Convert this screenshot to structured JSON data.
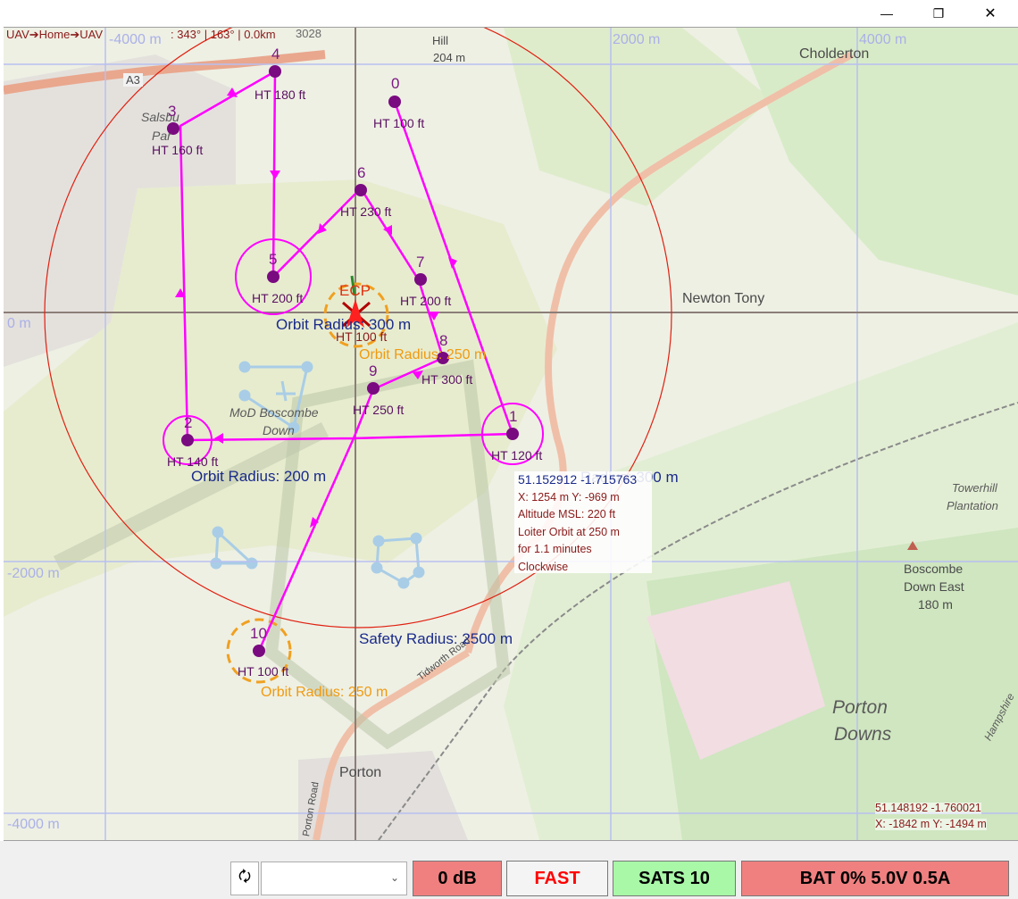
{
  "window": {
    "minimize_glyph": "—",
    "restore_glyph": "❐",
    "close_glyph": "✕"
  },
  "map": {
    "breadcrumb": "UAV➔Home➔UAV",
    "bearing_readout": ": 343° | 163° | 0.0km",
    "hud_number": "3028",
    "grid_labels": [
      "-4000 m",
      "2000 m",
      "4000 m",
      "0 m",
      "-2000 m",
      "-4000 m"
    ],
    "places": {
      "hill": "Hill",
      "hill_height": "204 m",
      "cholderton": "Cholderton",
      "newton_tony": "Newton Tony",
      "a3": "A3",
      "salsbury": "Salsbu",
      "park": "Par",
      "mod_boscombe_1": "MoD Boscombe",
      "mod_boscombe_2": "Down",
      "towerhill_1": "Towerhill",
      "towerhill_2": "Plantation",
      "boscombe_east_1": "Boscombe",
      "boscombe_east_2": "Down East",
      "boscombe_east_3": "180 m",
      "porton_downs_1": "Porton",
      "porton_downs_2": "Downs",
      "porton": "Porton",
      "road_tidworth": "Tidworth Road",
      "road_porton": "Porton Road",
      "hampshire": "Hampshire"
    },
    "waypoints": [
      {
        "num": "0",
        "ht": "HT 100 ft"
      },
      {
        "num": "1",
        "ht": "HT 120 ft"
      },
      {
        "num": "2",
        "ht": "HT 140 ft"
      },
      {
        "num": "3",
        "ht": "HT 160 ft"
      },
      {
        "num": "4",
        "ht": "HT 180 ft"
      },
      {
        "num": "5",
        "ht": "HT 200 ft"
      },
      {
        "num": "6",
        "ht": "HT 230 ft"
      },
      {
        "num": "7",
        "ht": "HT 200 ft"
      },
      {
        "num": "8",
        "ht": "HT 300 ft"
      },
      {
        "num": "9",
        "ht": "HT 250 ft"
      },
      {
        "num": "10",
        "ht": "HT 100 ft"
      }
    ],
    "ecp_label": "ECP",
    "home_ht": "HT 100 ft",
    "orbit_labels": {
      "wp5": "Orbit Radius: 300 m",
      "home": "Orbit Radius: 250 m",
      "wp2": "Orbit Radius: 200 m",
      "wp1": "Radius: 300 m",
      "wp10": "Orbit Radius: 250 m"
    },
    "safety_radius": "Safety Radius: 2500 m",
    "tooltip": {
      "coords": "51.152912 -1.715763",
      "xy": "X: 1254 m Y: -969 m",
      "altitude": "Altitude MSL: 220 ft",
      "loiter": "Loiter Orbit at 250 m",
      "duration": " for 1.1 minutes",
      "direction": " Clockwise"
    },
    "cursor_readout": {
      "latlon": "51.148192 -1.760021",
      "xy": "X: -1842 m Y: -1494 m"
    }
  },
  "statusbar": {
    "refresh_glyph": "🗘",
    "combo_value": "",
    "combo_arrow": "⌄",
    "signal": "0 dB",
    "speed": "FAST",
    "sats": "SATS 10",
    "battery": "BAT 0% 5.0V 0.5A"
  },
  "colors": {
    "waypoint": "#7a0a80",
    "route": "#ff00ff",
    "safety_circle": "#e02010",
    "orbit_orange": "#f0a020",
    "signal_bg": "#f08080",
    "speed_text": "#ff0000",
    "sats_bg": "#a8f8a8",
    "battery_bg": "#f08080"
  }
}
